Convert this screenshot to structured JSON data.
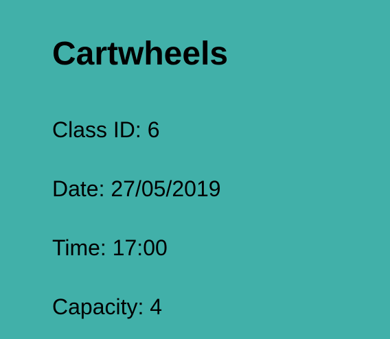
{
  "class": {
    "title": "Cartwheels",
    "class_id": "Class ID: 6",
    "date": "Date: 27/05/2019",
    "time": "Time: 17:00",
    "capacity": "Capacity: 4"
  },
  "colors": {
    "background": "#41b0a9",
    "text": "#000000"
  }
}
